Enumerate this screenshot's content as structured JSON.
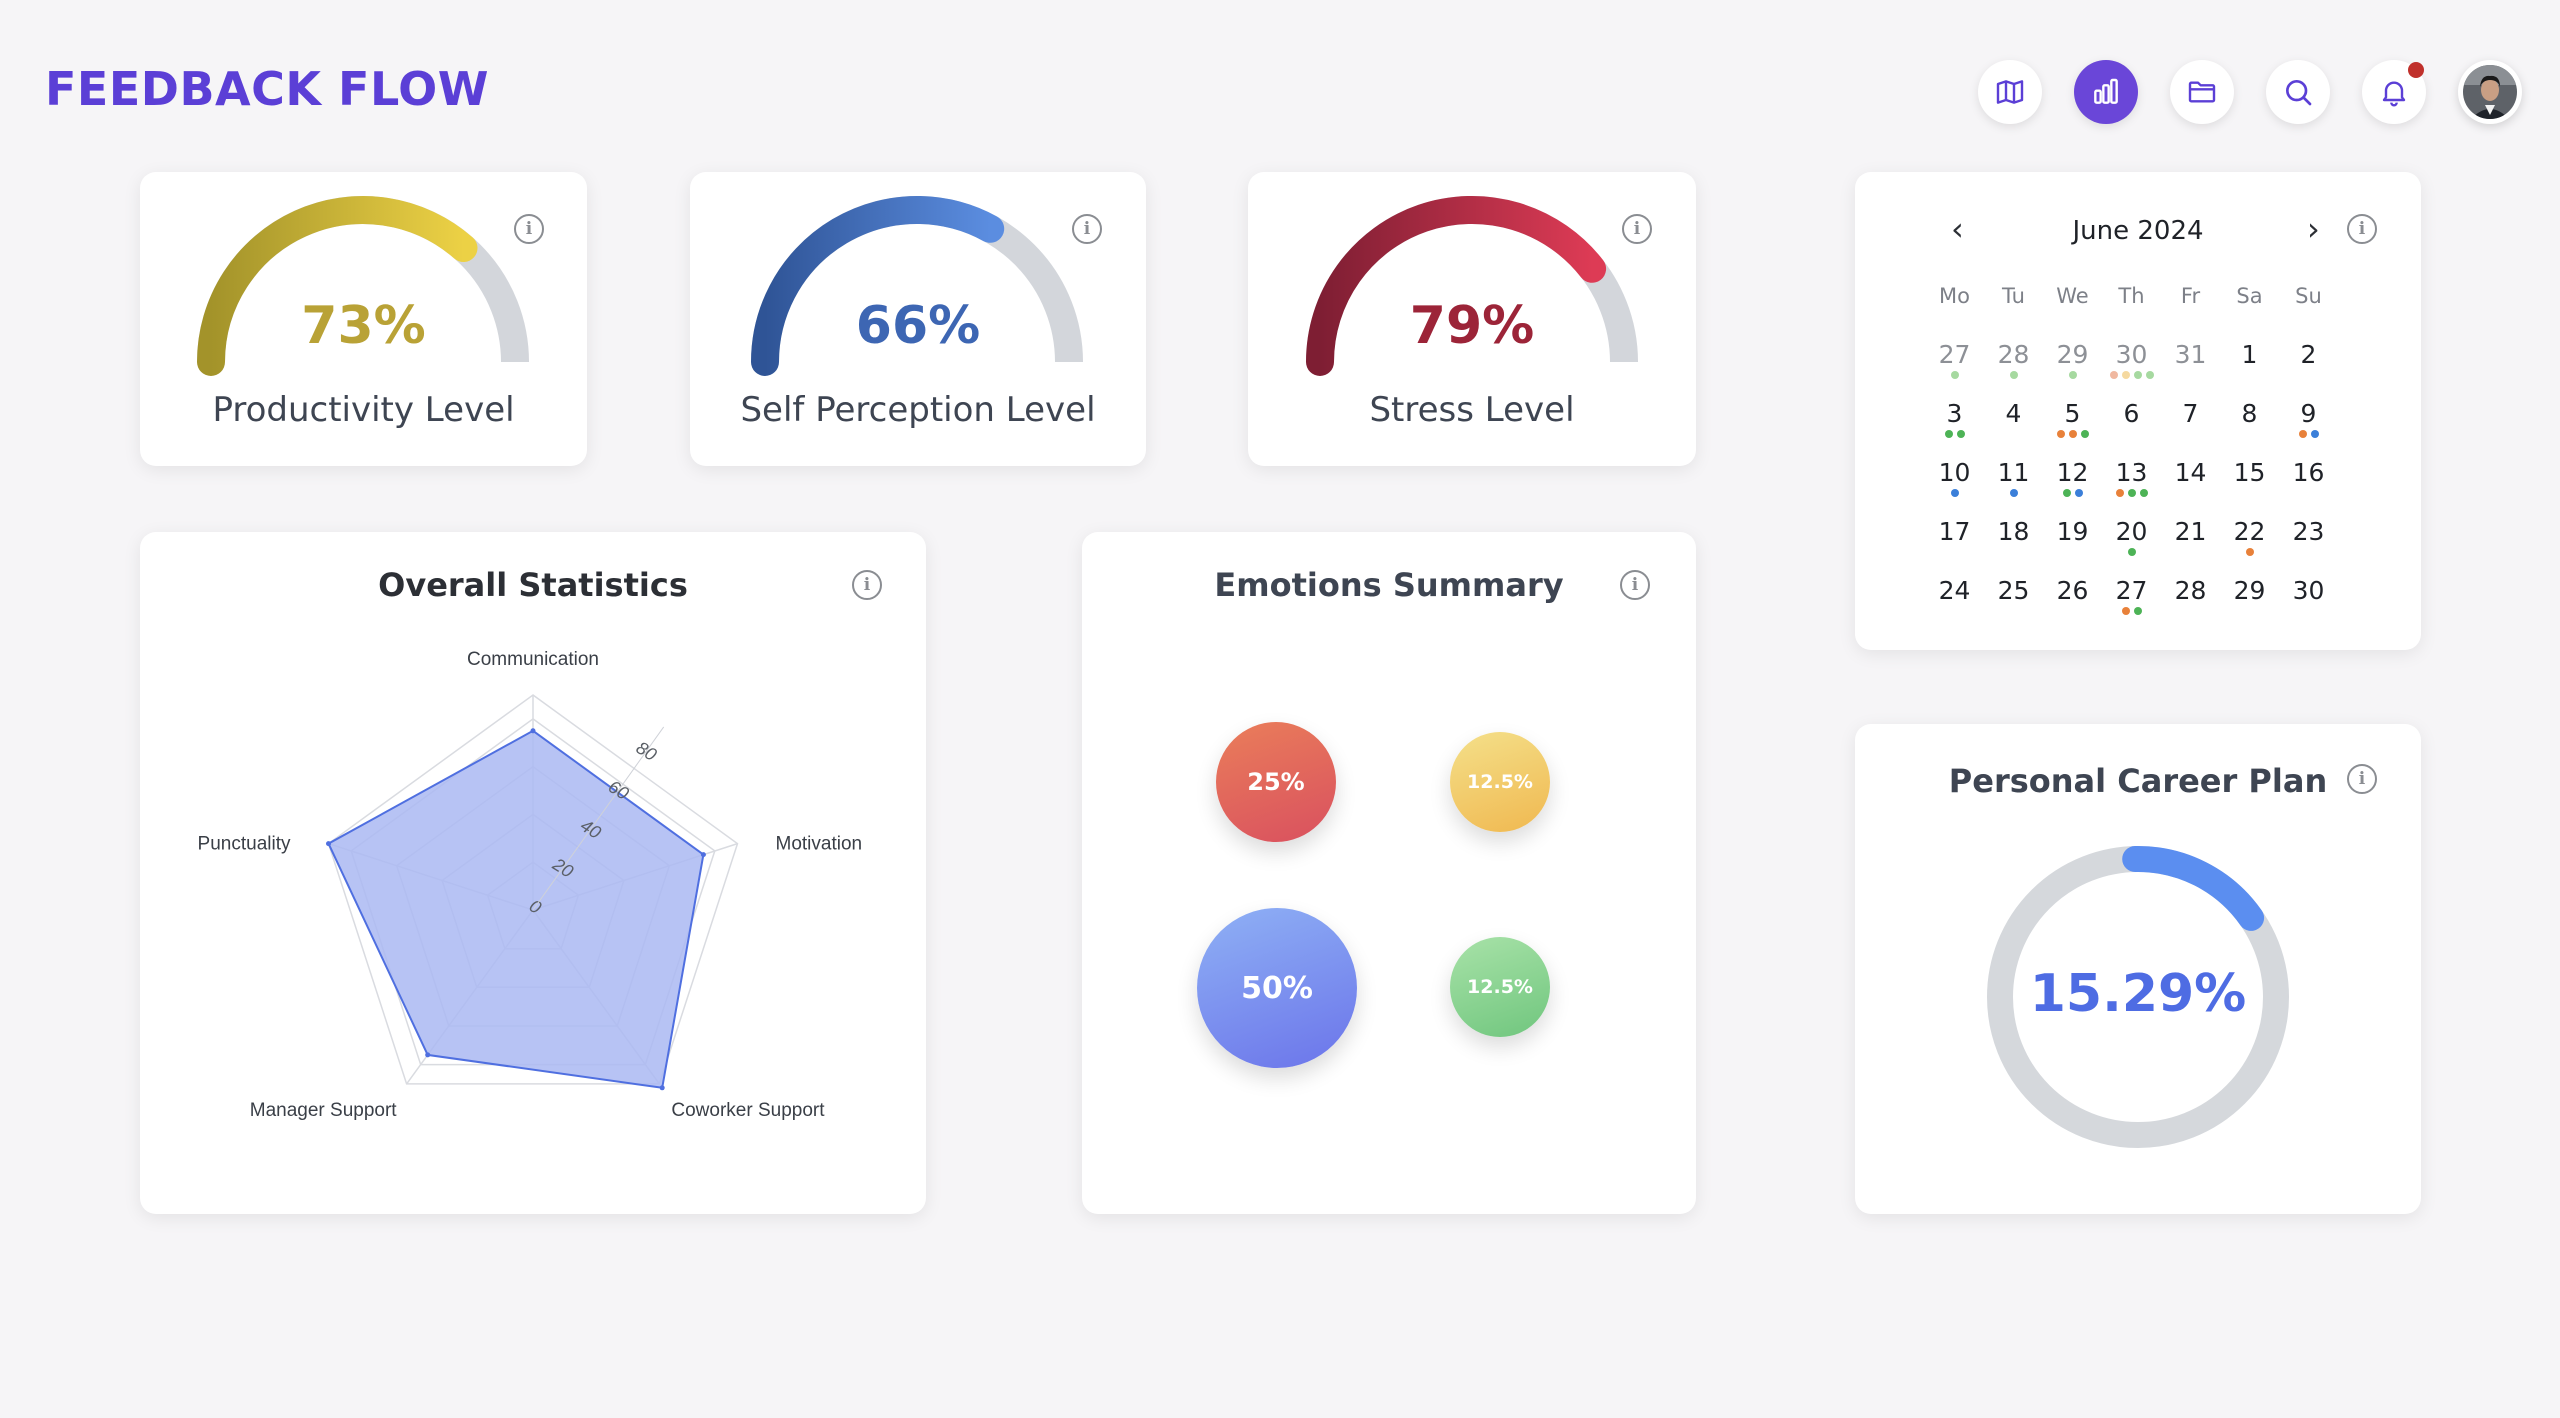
{
  "app": {
    "title": "FEEDBACK FLOW"
  },
  "nav": [
    {
      "icon": "map-icon",
      "active": false
    },
    {
      "icon": "bar-chart-icon",
      "active": true
    },
    {
      "icon": "folder-icon",
      "active": false
    },
    {
      "icon": "search-icon",
      "active": false
    },
    {
      "icon": "bell-icon",
      "active": false,
      "notification": true
    }
  ],
  "gauges": [
    {
      "value": "73%",
      "percent": 73,
      "label": "Productivity Level",
      "color_start": "#a3932a",
      "color_end": "#ecd145",
      "text_color": "#b9a236"
    },
    {
      "value": "66%",
      "percent": 66,
      "label": "Self Perception Level",
      "color_start": "#2f5496",
      "color_end": "#5b8de0",
      "text_color": "#3d66b3"
    },
    {
      "value": "79%",
      "percent": 79,
      "label": "Stress Level",
      "color_start": "#7e1e33",
      "color_end": "#dd3b55",
      "text_color": "#9c2438"
    }
  ],
  "calendar": {
    "month": "June 2024",
    "weekdays": [
      "Mo",
      "Tu",
      "We",
      "Th",
      "Fr",
      "Sa",
      "Su"
    ],
    "weeks": [
      [
        {
          "d": "27",
          "m": true,
          "dots": [
            "#a6d9a0"
          ]
        },
        {
          "d": "28",
          "m": true,
          "dots": [
            "#a6d9a0"
          ]
        },
        {
          "d": "29",
          "m": true,
          "dots": [
            "#a6d9a0"
          ]
        },
        {
          "d": "30",
          "m": true,
          "dots": [
            "#f0b8a0",
            "#f5d9a0",
            "#a6d9a0",
            "#a6d9a0"
          ]
        },
        {
          "d": "31",
          "m": true,
          "dots": []
        },
        {
          "d": "1",
          "dots": []
        },
        {
          "d": "2",
          "dots": []
        }
      ],
      [
        {
          "d": "3",
          "dots": [
            "#4db356",
            "#4db356"
          ]
        },
        {
          "d": "4",
          "dots": []
        },
        {
          "d": "5",
          "dots": [
            "#e8813a",
            "#e8813a",
            "#4db356"
          ]
        },
        {
          "d": "6",
          "dots": []
        },
        {
          "d": "7",
          "dots": []
        },
        {
          "d": "8",
          "dots": []
        },
        {
          "d": "9",
          "dots": [
            "#e8813a",
            "#3b7fd9"
          ]
        }
      ],
      [
        {
          "d": "10",
          "dots": [
            "#3b7fd9"
          ]
        },
        {
          "d": "11",
          "dots": [
            "#3b7fd9"
          ]
        },
        {
          "d": "12",
          "dots": [
            "#4db356",
            "#3b7fd9"
          ]
        },
        {
          "d": "13",
          "dots": [
            "#e8813a",
            "#4db356",
            "#4db356"
          ]
        },
        {
          "d": "14",
          "dots": []
        },
        {
          "d": "15",
          "dots": []
        },
        {
          "d": "16",
          "dots": []
        }
      ],
      [
        {
          "d": "17",
          "dots": []
        },
        {
          "d": "18",
          "dots": []
        },
        {
          "d": "19",
          "dots": []
        },
        {
          "d": "20",
          "dots": [
            "#4db356"
          ]
        },
        {
          "d": "21",
          "dots": []
        },
        {
          "d": "22",
          "dots": [
            "#e8813a"
          ]
        },
        {
          "d": "23",
          "dots": []
        }
      ],
      [
        {
          "d": "24",
          "dots": []
        },
        {
          "d": "25",
          "dots": []
        },
        {
          "d": "26",
          "dots": []
        },
        {
          "d": "27",
          "dots": [
            "#e8813a",
            "#4db356"
          ]
        },
        {
          "d": "28",
          "dots": []
        },
        {
          "d": "29",
          "dots": []
        },
        {
          "d": "30",
          "dots": []
        }
      ]
    ]
  },
  "overall": {
    "title": "Overall Statistics",
    "chart_data": {
      "type": "radar",
      "categories": [
        "Communication",
        "Motivation",
        "Coworker Support",
        "Manager Support",
        "Punctuality"
      ],
      "values": [
        75,
        75,
        92,
        75,
        90
      ],
      "ticks": [
        "0",
        "20",
        "40",
        "60",
        "80"
      ],
      "rmax": 90,
      "fill": "#aab9f2",
      "stroke": "#4f6fe0"
    }
  },
  "emotions": {
    "title": "Emotions Summary",
    "bubbles": [
      {
        "label": "25%",
        "value": 25,
        "color_a": "#ea7e5a",
        "color_b": "#d9505f"
      },
      {
        "label": "12.5%",
        "value": 12.5,
        "color_a": "#f4e08a",
        "color_b": "#f0b850"
      },
      {
        "label": "50%",
        "value": 50,
        "color_a": "#8fb1f5",
        "color_b": "#6b74ea"
      },
      {
        "label": "12.5%",
        "value": 12.5,
        "color_a": "#a8e2a8",
        "color_b": "#70c67e"
      }
    ]
  },
  "career": {
    "title": "Personal Career Plan",
    "value": "15.29%",
    "percent": 15.29,
    "color": "#5b8ef0",
    "track": "#d5d8dc"
  }
}
